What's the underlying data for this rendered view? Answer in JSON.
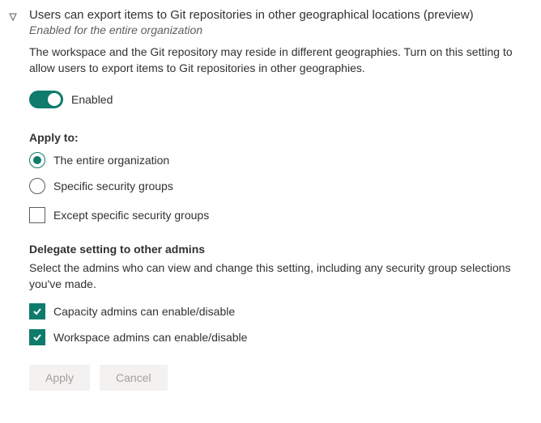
{
  "setting": {
    "title": "Users can export items to Git repositories in other geographical locations (preview)",
    "scope_subtitle": "Enabled for the entire organization",
    "description": "The workspace and the Git repository may reside in different geographies. Turn on this setting to allow users to export items to Git repositories in other geographies.",
    "toggle": {
      "enabled": true,
      "label": "Enabled"
    }
  },
  "apply_to": {
    "heading": "Apply to:",
    "options": {
      "entire_org": "The entire organization",
      "specific_groups": "Specific security groups"
    },
    "selected": "entire_org",
    "except_label": "Except specific security groups",
    "except_checked": false
  },
  "delegate": {
    "heading": "Delegate setting to other admins",
    "description": "Select the admins who can view and change this setting, including any security group selections you've made.",
    "capacity_label": "Capacity admins can enable/disable",
    "capacity_checked": true,
    "workspace_label": "Workspace admins can enable/disable",
    "workspace_checked": true
  },
  "buttons": {
    "apply": "Apply",
    "cancel": "Cancel"
  }
}
